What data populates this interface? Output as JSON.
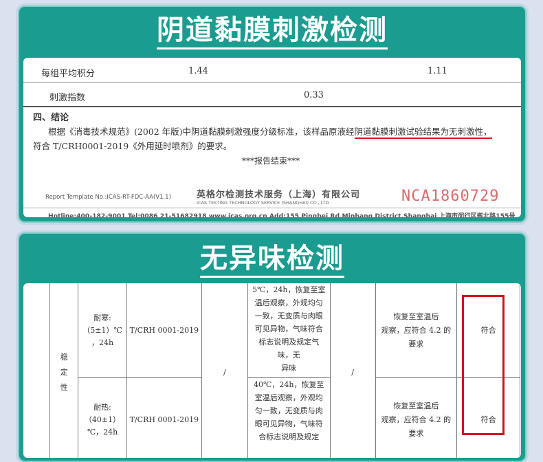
{
  "section1": {
    "title": "阴道黏膜刺激检测",
    "row_avg": {
      "label": "每组平均积分",
      "val1": "1.44",
      "val2": "1.11"
    },
    "row_index": {
      "label": "刺激指数",
      "value": "0.33"
    },
    "conclusion_heading": "四、结论",
    "conclusion_pre": "根据《消毒技术规范》(2002 年版)中阴道黏膜刺激强度分级标准，该样品原液经",
    "conclusion_highlight": "阴道黏膜刺激试验结果为无刺激性，",
    "conclusion_line2": "符合 T/CRH0001-2019《外用延时喷剂》的要求。",
    "end_mark": "***报告结束***",
    "template_label": "Report Template No.:ICAS-RT-FDC-AA(V1.1)",
    "company_cn": "英格尔检测技术服务（上海）有限公司",
    "company_en": "ICAS TESTING TECHNOLOGY SERVICE (SHANGHAI) CO., LTD",
    "stamp_code": "NCA1860729",
    "footer": "Hotline:400-182-9001  Tel:0086 21-51682918  www.icas.org.cn  Add:155 Pingbei Rd,Minhang District,Shanghai 上海市闵行区瓶北路155号"
  },
  "section2": {
    "title": "无异味检测",
    "category": "稳\n定\n性",
    "rows": [
      {
        "condition": "耐寒:\n（5±1）℃\n，24h",
        "standard": "T/CRH 0001-2019",
        "col4": "/",
        "method": "5℃，24h，恢复至室\n温后观察，外观均匀\n一致，无变质与肉眼\n可见异物，气味符合\n标志说明及规定气\n味，无\n异味",
        "col6": "/",
        "requirement": "恢复至室温后\n观察，应符合 4.2 的\n要求",
        "result": "符合"
      },
      {
        "condition": "耐热:\n（40±1）\n℃，24h",
        "standard": "T/CRH 0001-2019",
        "col4": "/",
        "method": "40℃，24h，恢复至\n室温后观察，外观均\n匀一致，无变质与肉\n眼可见异物，气味符\n合标志说明及规定",
        "col6": "/",
        "requirement": "恢复至室温后\n观察，应符合 4.2 的\n要求",
        "result": "符合"
      }
    ]
  },
  "colors": {
    "teal": "#1b9c90",
    "highlight_red": "#e0141d",
    "stamp_red": "#d96b6b"
  }
}
